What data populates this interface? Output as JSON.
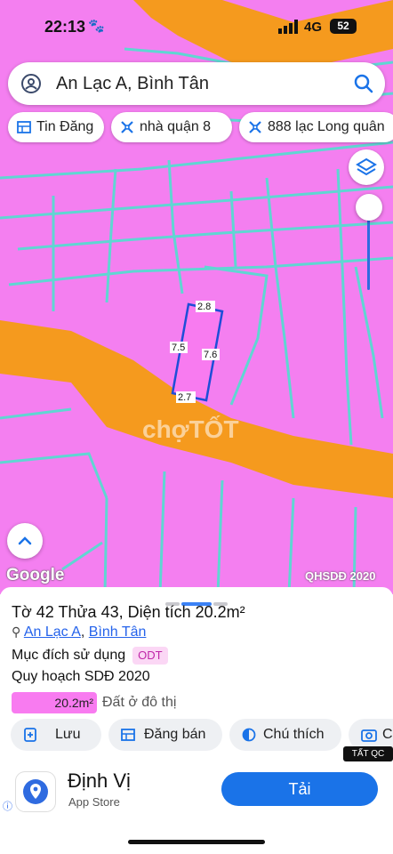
{
  "status_bar": {
    "time": "22:13",
    "network": "4G",
    "battery": "52"
  },
  "search": {
    "query": "An Lạc A, Bình Tân"
  },
  "chips": [
    {
      "label": "Tin Đăng",
      "icon": "grid-icon"
    },
    {
      "label": "nhà quận 8",
      "icon": "tag-icon"
    },
    {
      "label": "888 lạc Long quân",
      "icon": "tag-icon"
    }
  ],
  "map": {
    "parcel_labels": {
      "top": "2.8",
      "left": "7.5",
      "right": "7.6",
      "bottom": "2.7"
    },
    "watermark": "chợTỐT",
    "google_label": "Google",
    "layer_source": "QHSDĐ 2020",
    "colors": {
      "land": "#f47ff0",
      "road": "#f59a1e",
      "lines": "#5fd6d2"
    }
  },
  "sheet": {
    "title": "Tờ 42 Thửa 43, Diện tích 20.2m²",
    "address": {
      "ward": "An Lạc A",
      "district": "Bình Tân",
      "separator": ","
    },
    "purpose_label": "Mục đích sử dụng",
    "purpose_code": "ODT",
    "plan_label": "Quy hoạch SDĐ 2020",
    "plan_area": "20.2m²",
    "plan_type": "Đất ở đô thị",
    "actions": [
      {
        "label": "Lưu",
        "icon": "save-icon"
      },
      {
        "label": "Đăng bán",
        "icon": "post-icon"
      },
      {
        "label": "Chú thích",
        "icon": "legend-icon"
      },
      {
        "label": "C",
        "icon": "camera-icon"
      }
    ],
    "ad_badge": "TẤT QC",
    "ad": {
      "app_name": "Định Vị",
      "store": "App Store",
      "button": "Tải"
    }
  }
}
